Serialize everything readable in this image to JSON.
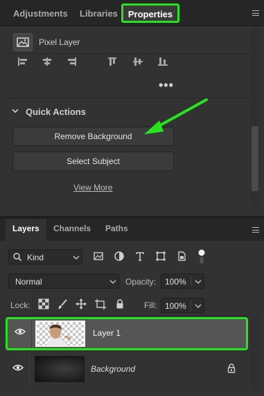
{
  "properties_panel": {
    "tabs": [
      {
        "label": "Adjustments"
      },
      {
        "label": "Libraries"
      },
      {
        "label": "Properties"
      }
    ],
    "active_tab": "Properties",
    "header": {
      "label": "Pixel Layer",
      "icon": "pixel-layer-icon"
    },
    "align_icons": [
      "align-left-icon",
      "align-horizontal-center-icon",
      "align-right-icon",
      "align-top-icon",
      "align-vertical-center-icon",
      "align-bottom-icon"
    ],
    "more_label": "•••",
    "quick_actions": {
      "title": "Quick Actions",
      "buttons": [
        {
          "label": "Remove Background"
        },
        {
          "label": "Select Subject"
        }
      ],
      "view_more": "View More"
    },
    "highlight_color": "#26e51f",
    "arrow_color": "#26e51f"
  },
  "layers_panel": {
    "tabs": [
      {
        "label": "Layers"
      },
      {
        "label": "Channels"
      },
      {
        "label": "Paths"
      }
    ],
    "active_tab": "Layers",
    "filter": {
      "kind_label": "Kind",
      "icons": [
        "image-filter-icon",
        "adjustment-filter-icon",
        "type-filter-icon",
        "shape-filter-icon",
        "smart-object-filter-icon"
      ]
    },
    "blend_mode": "Normal",
    "opacity_label": "Opacity:",
    "opacity_value": "100%",
    "lock_label": "Lock:",
    "lock_icons": [
      "lock-transparent-pixels-icon",
      "lock-image-pixels-icon",
      "lock-position-icon",
      "artboard-nesting-icon",
      "lock-all-icon"
    ],
    "fill_label": "Fill:",
    "fill_value": "100%",
    "layers": [
      {
        "name": "Layer 1",
        "visible": true,
        "selected": true,
        "locked": false
      },
      {
        "name": "Background",
        "visible": true,
        "selected": false,
        "locked": true
      }
    ]
  }
}
